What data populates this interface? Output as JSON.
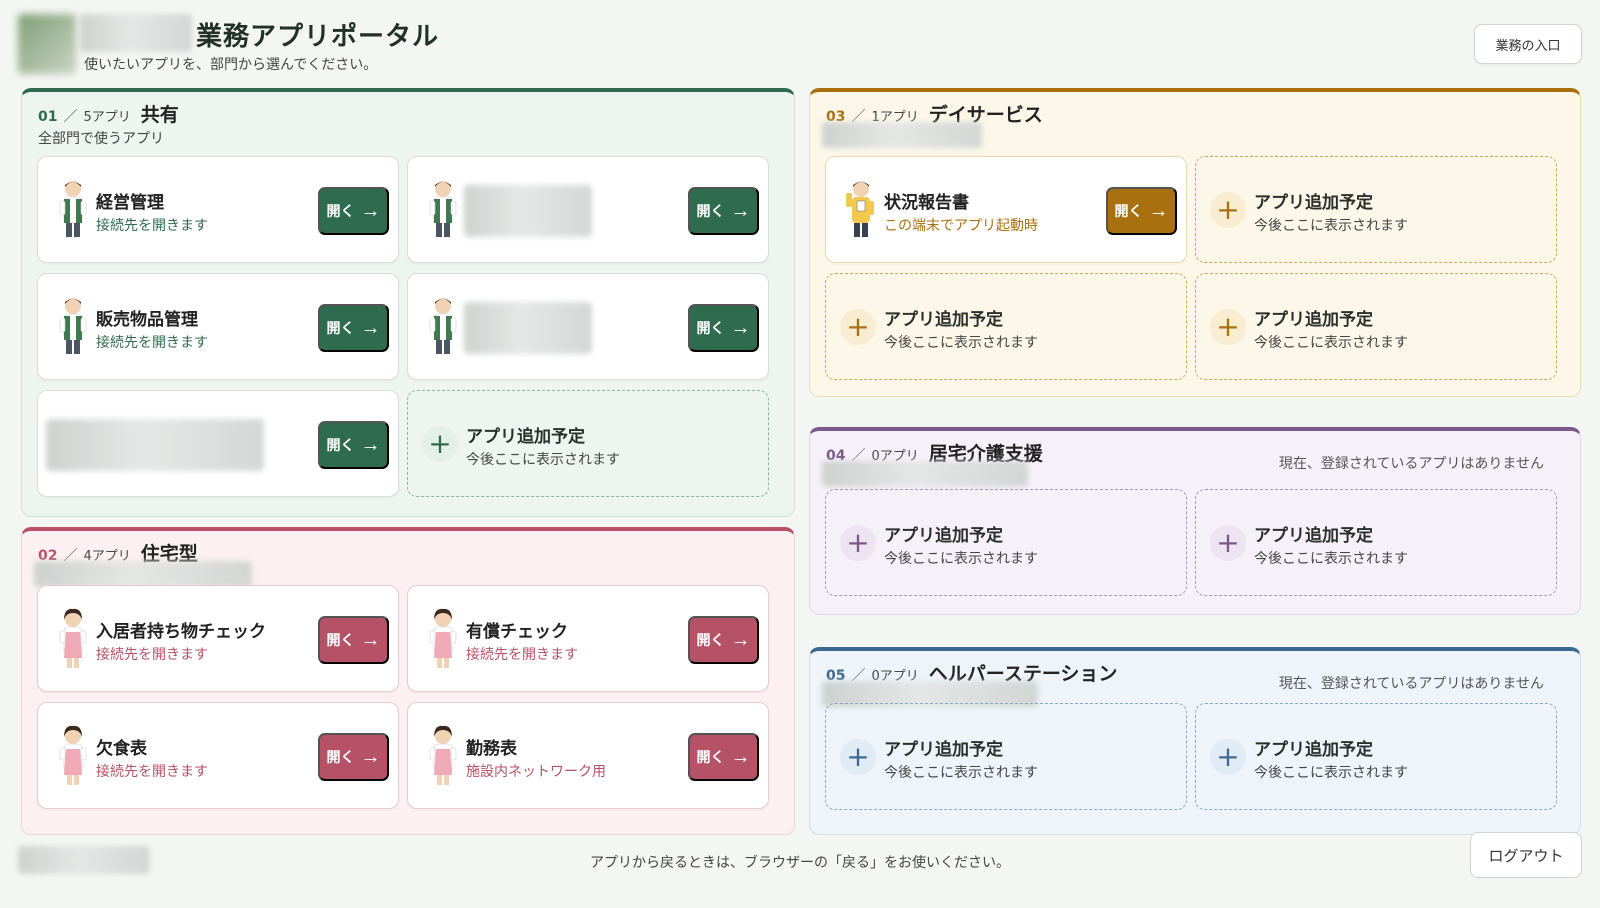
{
  "header": {
    "title": "業務アプリポータル",
    "subtitle": "使いたいアプリを、部門から選んでください。",
    "top_button": "業務の入口"
  },
  "labels": {
    "open": "開く",
    "arrow": "→",
    "plus": "+",
    "sep": "／",
    "placeholder_title": "アプリ追加予定",
    "placeholder_sub": "今後ここに表示されます"
  },
  "colors": {
    "shared": "#2f6b4e",
    "housing": "#b55268",
    "day": "#a8700f",
    "care": "#7a5a8b",
    "helper": "#3d6a91"
  },
  "sections": [
    {
      "num": "01",
      "count": "5アプリ",
      "name": "共有",
      "desc": "全部門で使うアプリ",
      "cards": [
        {
          "title": "経営管理",
          "sub": "接続先を開きます"
        }
      ]
    },
    {
      "num": "02",
      "count": "4アプリ",
      "name": "住宅型",
      "cards": [
        {
          "title": "入居者持ち物チェック",
          "sub": "接続先を開きます"
        },
        {
          "title": "有償チェック",
          "sub": "接続先を開きます"
        },
        {
          "title": "欠食表",
          "sub": "接続先を開きます"
        },
        {
          "title": "勤務表",
          "sub": "施設内ネットワーク用"
        }
      ]
    },
    {
      "num": "03",
      "count": "1アプリ",
      "name": "デイサービス",
      "cards": [
        {
          "title": "状況報告書",
          "sub": "この端末でアプリ起動時"
        }
      ]
    },
    {
      "num": "04",
      "count": "0アプリ",
      "name": "居宅介護支援",
      "note": "現在、登録されているアプリはありません"
    },
    {
      "num": "05",
      "count": "0アプリ",
      "name": "ヘルパーステーション",
      "note": "現在、登録されているアプリはありません"
    }
  ],
  "extra_cards": [
    {
      "title": "販売物品管理",
      "sub": "接続先を開きます"
    }
  ],
  "footer": {
    "text": "アプリから戻るときは、ブラウザーの「戻る」をお使いください。",
    "logout": "ログアウト"
  },
  "icons": {
    "avatar_green": "staff-man-green-vest-icon",
    "avatar_pink": "staff-woman-pink-apron-icon",
    "avatar_yellow": "staff-man-yellow-icon",
    "open": "arrow-right-icon",
    "add": "plus-icon"
  }
}
